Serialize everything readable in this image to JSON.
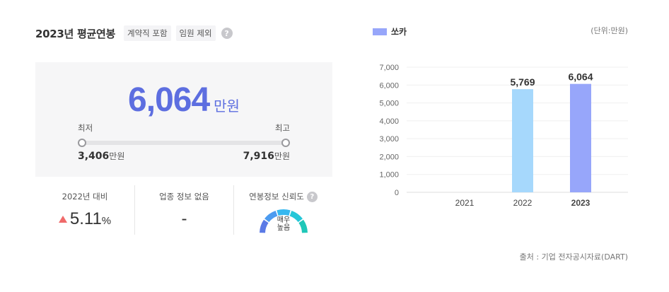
{
  "header": {
    "title": "2023년 평균연봉",
    "tags": [
      "계약직 포함",
      "임원 제외"
    ],
    "help": "?"
  },
  "salary": {
    "value": "6,064",
    "unit": "만원",
    "min_label": "최저",
    "max_label": "최고",
    "min_value": "3,406",
    "max_value": "7,916",
    "value_unit": "만원"
  },
  "stats": {
    "yoy": {
      "label": "2022년 대비",
      "value": "5.11",
      "unit": "%"
    },
    "industry": {
      "label": "업종 정보 없음",
      "value": "-"
    },
    "reliability": {
      "label": "연봉정보 신뢰도",
      "line1": "매우",
      "line2": "높음",
      "level": 1.0
    }
  },
  "colors": {
    "accent": "#5d6ee0",
    "bar_2022": "#a6d8fc",
    "bar_2023": "#97a6fa",
    "up": "#f06a6a"
  },
  "legend_label": "쏘카",
  "unit_note": "(단위:만원)",
  "source_note": "출처 : 기업 전자공시자료(DART)",
  "chart_data": {
    "type": "bar",
    "categories": [
      "2021",
      "2022",
      "2023"
    ],
    "series": [
      {
        "name": "쏘카",
        "values": [
          null,
          5769,
          6064
        ]
      }
    ],
    "value_labels": [
      "",
      "5,769",
      "6,064"
    ],
    "yticks": [
      "0",
      "1,000",
      "2,000",
      "3,000",
      "4,000",
      "5,000",
      "6,000",
      "7,000"
    ],
    "ylim": [
      0,
      7000
    ],
    "grid": true,
    "legend": "top-left"
  }
}
